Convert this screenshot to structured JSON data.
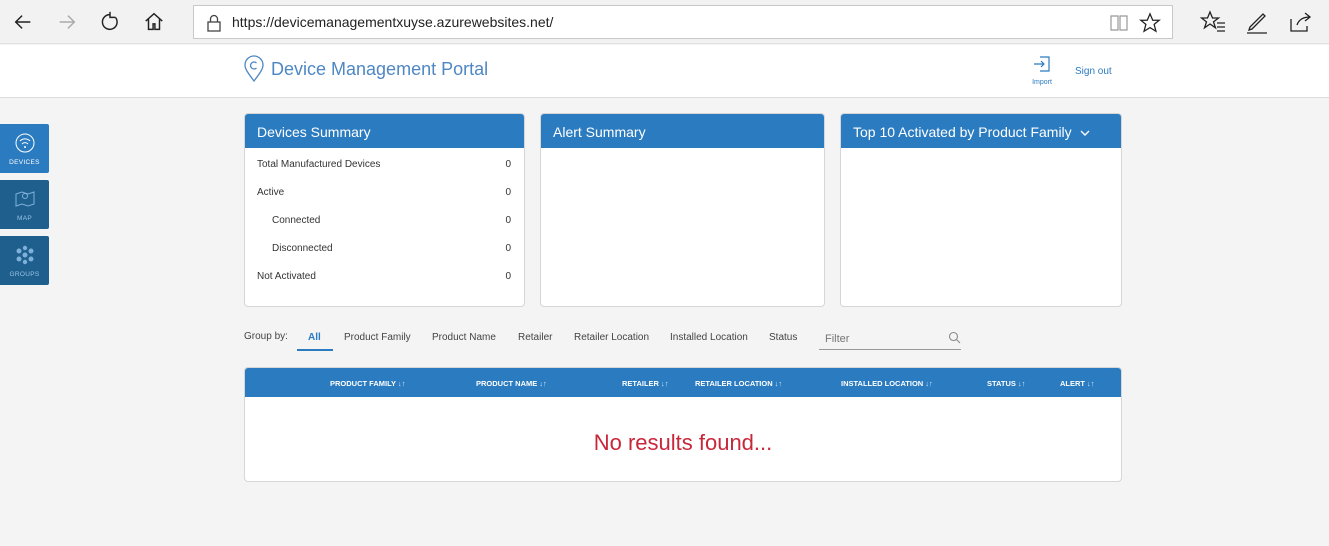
{
  "browser": {
    "url": "https://devicemanagementxuyse.azurewebsites.net/"
  },
  "header": {
    "title": "Device Management Portal",
    "import_label": "Import",
    "signout_label": "Sign out"
  },
  "sidenav": {
    "items": [
      {
        "label": "DEVICES",
        "icon": "devices-icon",
        "active": true
      },
      {
        "label": "MAP",
        "icon": "map-icon",
        "active": false
      },
      {
        "label": "GROUPS",
        "icon": "groups-icon",
        "active": false
      }
    ]
  },
  "cards": {
    "devices_summary": {
      "title": "Devices Summary",
      "rows": [
        {
          "label": "Total Manufactured Devices",
          "value": "0"
        },
        {
          "label": "Active",
          "value": "0"
        },
        {
          "label": "Connected",
          "value": "0"
        },
        {
          "label": "Disconnected",
          "value": "0"
        },
        {
          "label": "Not Activated",
          "value": "0"
        }
      ]
    },
    "alert_summary": {
      "title": "Alert Summary"
    },
    "top10": {
      "title": "Top 10 Activated by Product Family"
    }
  },
  "filterbar": {
    "group_by_label": "Group by:",
    "tabs": [
      "All",
      "Product Family",
      "Product Name",
      "Retailer",
      "Retailer Location",
      "Installed Location",
      "Status"
    ],
    "active_tab": "All",
    "filter_placeholder": "Filter"
  },
  "table": {
    "columns": [
      "PRODUCT FAMILY",
      "PRODUCT NAME",
      "RETAILER",
      "RETAILER LOCATION",
      "INSTALLED LOCATION",
      "STATUS",
      "ALERT"
    ],
    "sort_glyph": "↓↑",
    "empty_message": "No results found..."
  },
  "colors": {
    "accent": "#2b7bc0",
    "nav_dark": "#1e5f8e",
    "error": "#c8273a"
  }
}
